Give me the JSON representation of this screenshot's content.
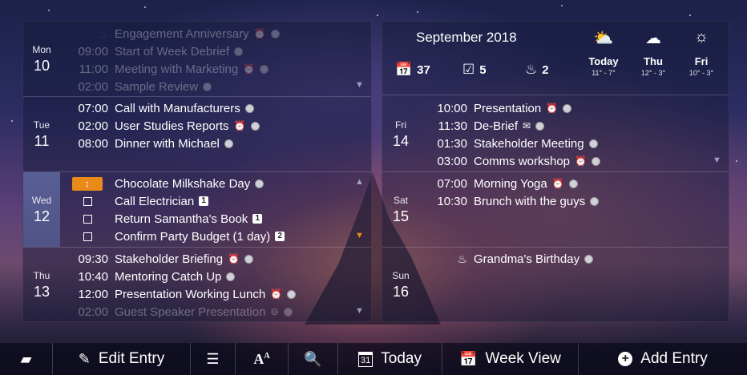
{
  "left_days": [
    {
      "dname": "Mon",
      "dnum": "10",
      "entries": [
        {
          "time": "",
          "title": "Engagement Anniversary",
          "dim": true
        },
        {
          "time": "09:00",
          "title": "Start of Week Debrief",
          "dim": true
        },
        {
          "time": "11:00",
          "title": "Meeting with Marketing",
          "dim": true
        },
        {
          "time": "02:00",
          "title": "Sample Review",
          "dim": true
        }
      ]
    },
    {
      "dname": "Tue",
      "dnum": "11",
      "entries": [
        {
          "time": "07:00",
          "title": "Call with Manufacturers"
        },
        {
          "time": "02:00",
          "title": "User Studies Reports"
        },
        {
          "time": "08:00",
          "title": "Dinner with Michael"
        }
      ]
    },
    {
      "dname": "Wed",
      "dnum": "12",
      "entries": [
        {
          "title": "Chocolate Milkshake Day"
        },
        {
          "title": "Call Electrician",
          "badge": "1"
        },
        {
          "title": "Return Samantha's Book",
          "badge": "1"
        },
        {
          "title": "Confirm Party Budget (1 day)",
          "badge": "2"
        }
      ]
    },
    {
      "dname": "Thu",
      "dnum": "13",
      "entries": [
        {
          "time": "09:30",
          "title": "Stakeholder Briefing"
        },
        {
          "time": "10:40",
          "title": "Mentoring Catch Up"
        },
        {
          "time": "12:00",
          "title": "Presentation Working Lunch"
        },
        {
          "time": "02:00",
          "title": "Guest Speaker Presentation",
          "dim": true
        }
      ]
    }
  ],
  "header": {
    "month_title": "September 2018",
    "stat_events": "37",
    "stat_tasks": "5",
    "stat_birthdays": "2",
    "weather": [
      {
        "day": "Today",
        "temp": "11° - 7°"
      },
      {
        "day": "Thu",
        "temp": "12° - 3°"
      },
      {
        "day": "Fri",
        "temp": "10° - 3°"
      }
    ]
  },
  "right_days": [
    {
      "dname": "Fri",
      "dnum": "14",
      "entries": [
        {
          "time": "10:00",
          "title": "Presentation"
        },
        {
          "time": "11:30",
          "title": "De-Brief"
        },
        {
          "time": "01:30",
          "title": "Stakeholder Meeting"
        },
        {
          "time": "03:00",
          "title": "Comms workshop"
        }
      ]
    },
    {
      "dname": "Sat",
      "dnum": "15",
      "entries": [
        {
          "time": "07:00",
          "title": "Morning Yoga"
        },
        {
          "time": "10:30",
          "title": "Brunch with the guys"
        }
      ]
    },
    {
      "dname": "Sun",
      "dnum": "16",
      "entries": [
        {
          "time": "",
          "title": "Grandma's Birthday"
        }
      ]
    }
  ],
  "toolbar": {
    "edit_label": "Edit Entry",
    "today_label": "Today",
    "week_label": "Week View",
    "add_label": "Add Entry",
    "cal_icon_num": "31"
  }
}
